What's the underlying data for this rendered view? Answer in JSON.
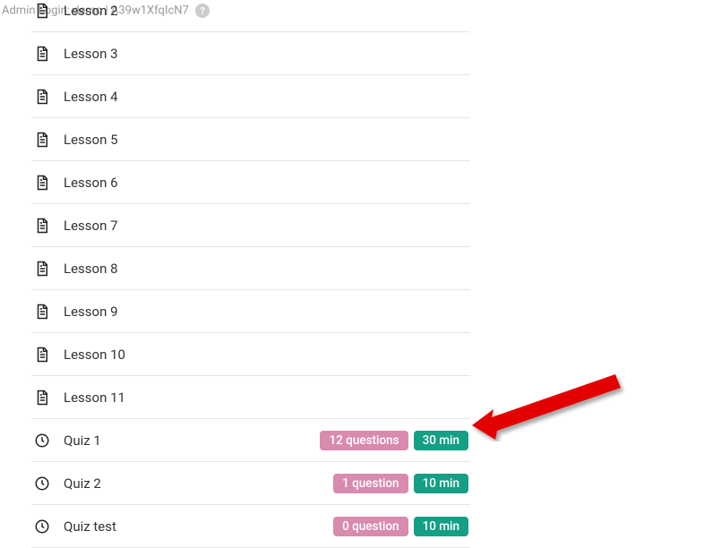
{
  "admin_bar": {
    "text": "Admin Login: demo | A39w1XfqIcN7",
    "help": "?"
  },
  "items": [
    {
      "type": "lesson",
      "label": "Lesson 2"
    },
    {
      "type": "lesson",
      "label": "Lesson 3"
    },
    {
      "type": "lesson",
      "label": "Lesson 4"
    },
    {
      "type": "lesson",
      "label": "Lesson 5"
    },
    {
      "type": "lesson",
      "label": "Lesson 6"
    },
    {
      "type": "lesson",
      "label": "Lesson 7"
    },
    {
      "type": "lesson",
      "label": "Lesson 8"
    },
    {
      "type": "lesson",
      "label": "Lesson 9"
    },
    {
      "type": "lesson",
      "label": "Lesson 10"
    },
    {
      "type": "lesson",
      "label": "Lesson 11"
    },
    {
      "type": "quiz",
      "label": "Quiz 1",
      "questions": "12 questions",
      "duration": "30 min"
    },
    {
      "type": "quiz",
      "label": "Quiz 2",
      "questions": "1 question",
      "duration": "10 min"
    },
    {
      "type": "quiz",
      "label": "Quiz test",
      "questions": "0 question",
      "duration": "10 min"
    }
  ]
}
